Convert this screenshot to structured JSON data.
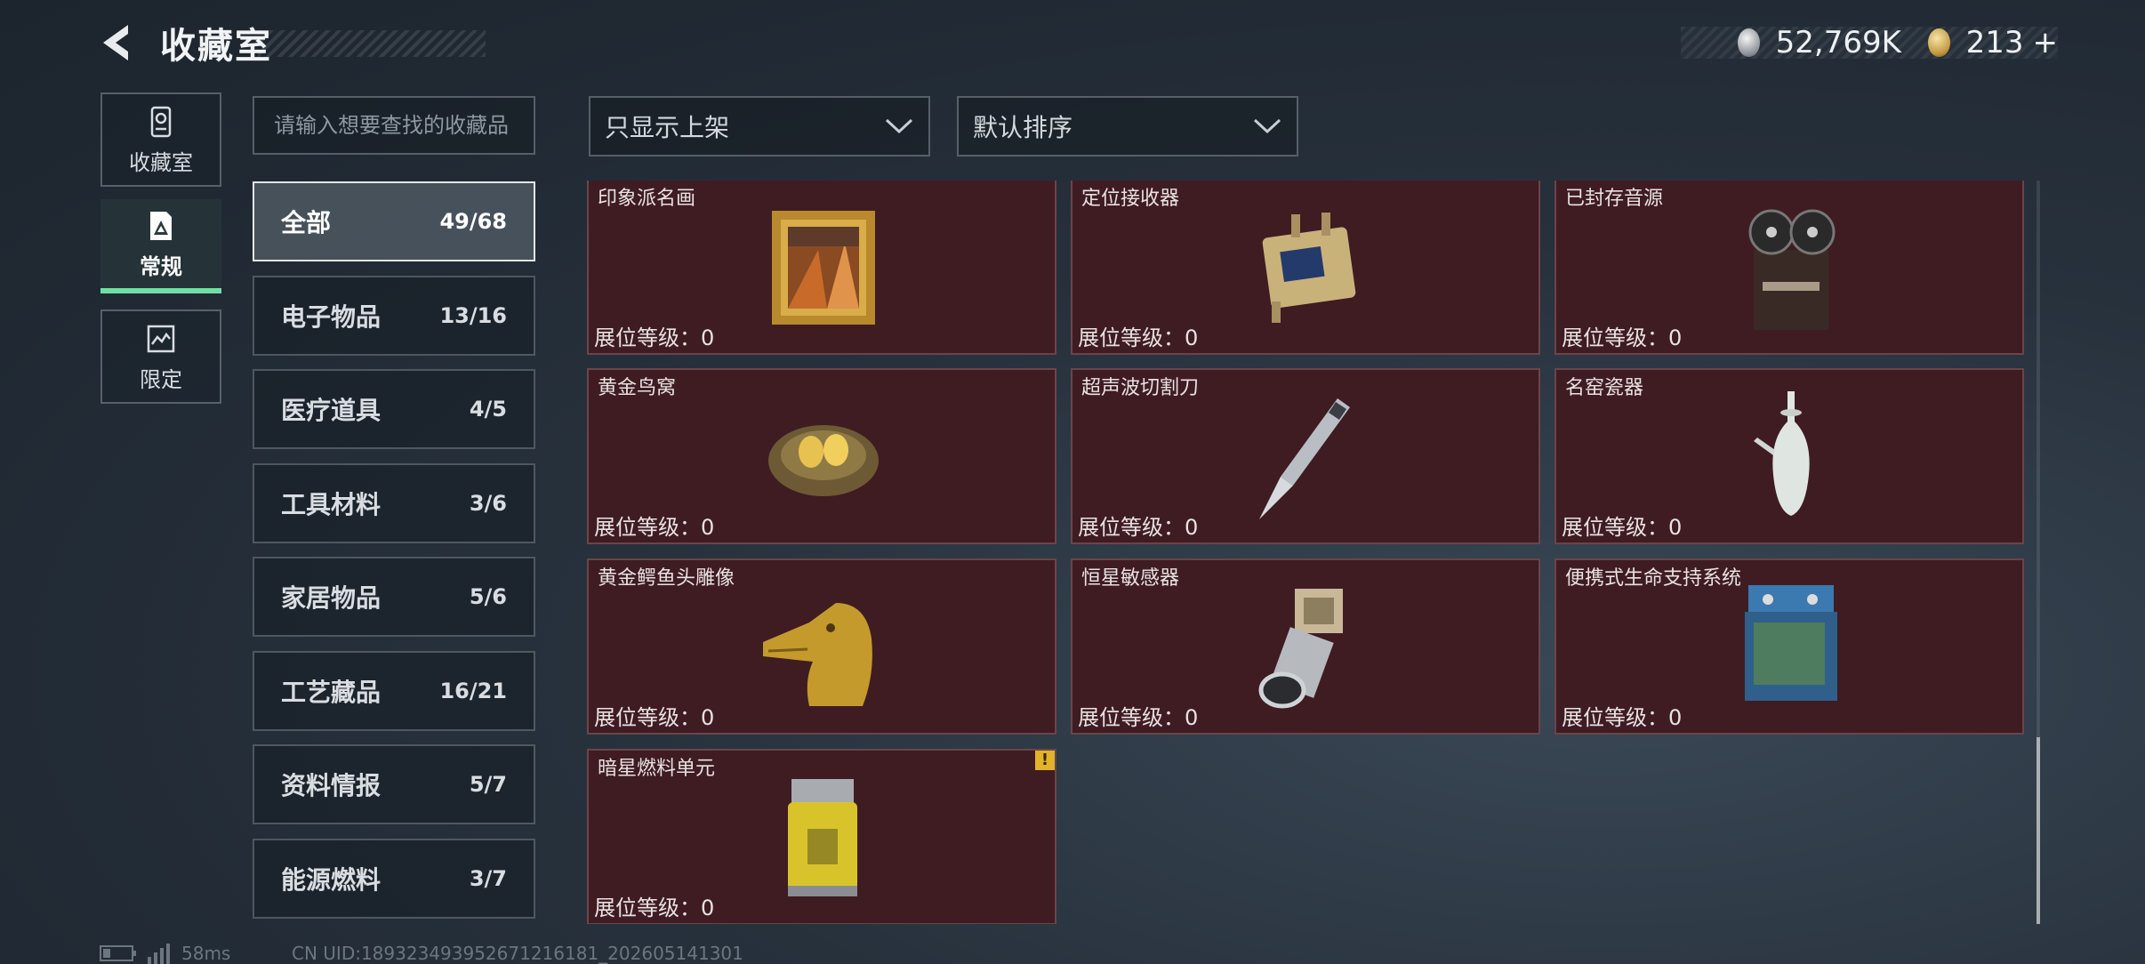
{
  "header": {
    "title": "收藏室",
    "coins": "52,769K",
    "tokens": "213",
    "tokens_add": "+"
  },
  "rail": [
    {
      "label": "收藏室",
      "icon": "shrine-icon"
    },
    {
      "label": "常规",
      "icon": "card-icon",
      "active": true
    },
    {
      "label": "限定",
      "icon": "limited-icon"
    }
  ],
  "search": {
    "placeholder": "请输入想要查找的收藏品"
  },
  "filters": {
    "show_label": "只显示上架",
    "sort_label": "默认排序"
  },
  "categories": [
    {
      "name": "全部",
      "count": "49/68",
      "active": true
    },
    {
      "name": "电子物品",
      "count": "13/16"
    },
    {
      "name": "医疗道具",
      "count": "4/5"
    },
    {
      "name": "工具材料",
      "count": "3/6"
    },
    {
      "name": "家居物品",
      "count": "5/6"
    },
    {
      "name": "工艺藏品",
      "count": "16/21"
    },
    {
      "name": "资料情报",
      "count": "5/7"
    },
    {
      "name": "能源燃料",
      "count": "3/7"
    }
  ],
  "items": [
    {
      "name": "印象派名画",
      "level": "展位等级：0",
      "icon": "painting-icon"
    },
    {
      "name": "定位接收器",
      "level": "展位等级：0",
      "icon": "receiver-icon"
    },
    {
      "name": "已封存音源",
      "level": "展位等级：0",
      "icon": "tape-recorder-icon"
    },
    {
      "name": "黄金鸟窝",
      "level": "展位等级：0",
      "icon": "golden-nest-icon"
    },
    {
      "name": "超声波切割刀",
      "level": "展位等级：0",
      "icon": "ultrasonic-knife-icon"
    },
    {
      "name": "名窑瓷器",
      "level": "展位等级：0",
      "icon": "porcelain-vase-icon"
    },
    {
      "name": "黄金鳄鱼头雕像",
      "level": "展位等级：0",
      "icon": "golden-crocodile-icon"
    },
    {
      "name": "恒星敏感器",
      "level": "展位等级：0",
      "icon": "star-sensor-icon"
    },
    {
      "name": "便携式生命支持系统",
      "level": "展位等级：0",
      "icon": "life-support-icon"
    },
    {
      "name": "暗星燃料单元",
      "level": "展位等级：0",
      "icon": "fuel-cell-icon",
      "warning": "!"
    }
  ],
  "footer": {
    "ping": "58ms",
    "uid": "CN UID:18932349395267121​6181_202605141301"
  },
  "colors": {
    "accent_green": "#6fe0a5",
    "card_bg": "#3f1c22",
    "warning_yellow": "#e0b32a"
  }
}
